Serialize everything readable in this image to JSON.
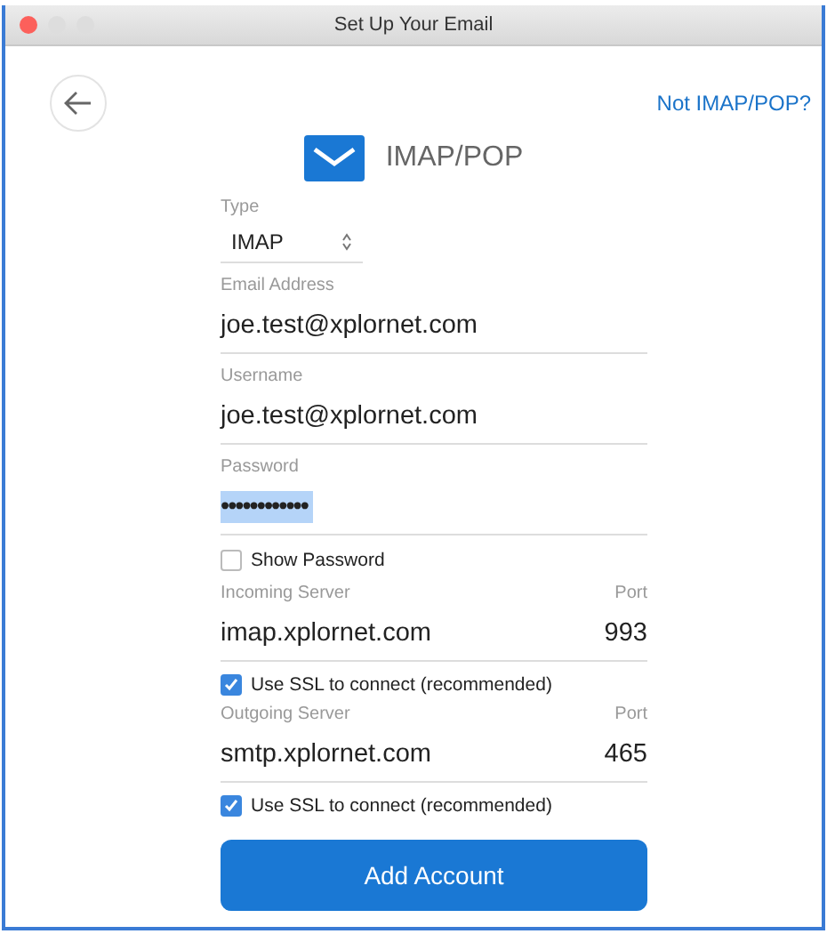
{
  "window": {
    "title": "Set Up Your Email"
  },
  "header": {
    "link": "Not IMAP/POP?",
    "heading": "IMAP/POP"
  },
  "type": {
    "label": "Type",
    "value": "IMAP"
  },
  "fields": [
    {
      "label": "Email Address",
      "value": "joe.test@xplornet.com",
      "highlighted": false
    },
    {
      "label": "Username",
      "value": "joe.test@xplornet.com",
      "highlighted": false
    },
    {
      "label": "Password",
      "value": "••••••••••••",
      "highlighted": true
    }
  ],
  "show_password": {
    "label": "Show Password",
    "checked": false
  },
  "servers": [
    {
      "label": "Incoming Server",
      "port_label": "Port",
      "value": "imap.xplornet.com",
      "port": "993",
      "ssl": {
        "label": "Use SSL to connect (recommended)",
        "checked": true
      }
    },
    {
      "label": "Outgoing Server",
      "port_label": "Port",
      "value": "smtp.xplornet.com",
      "port": "465",
      "ssl": {
        "label": "Use SSL to connect (recommended)",
        "checked": true
      }
    }
  ],
  "button": "Add Account"
}
